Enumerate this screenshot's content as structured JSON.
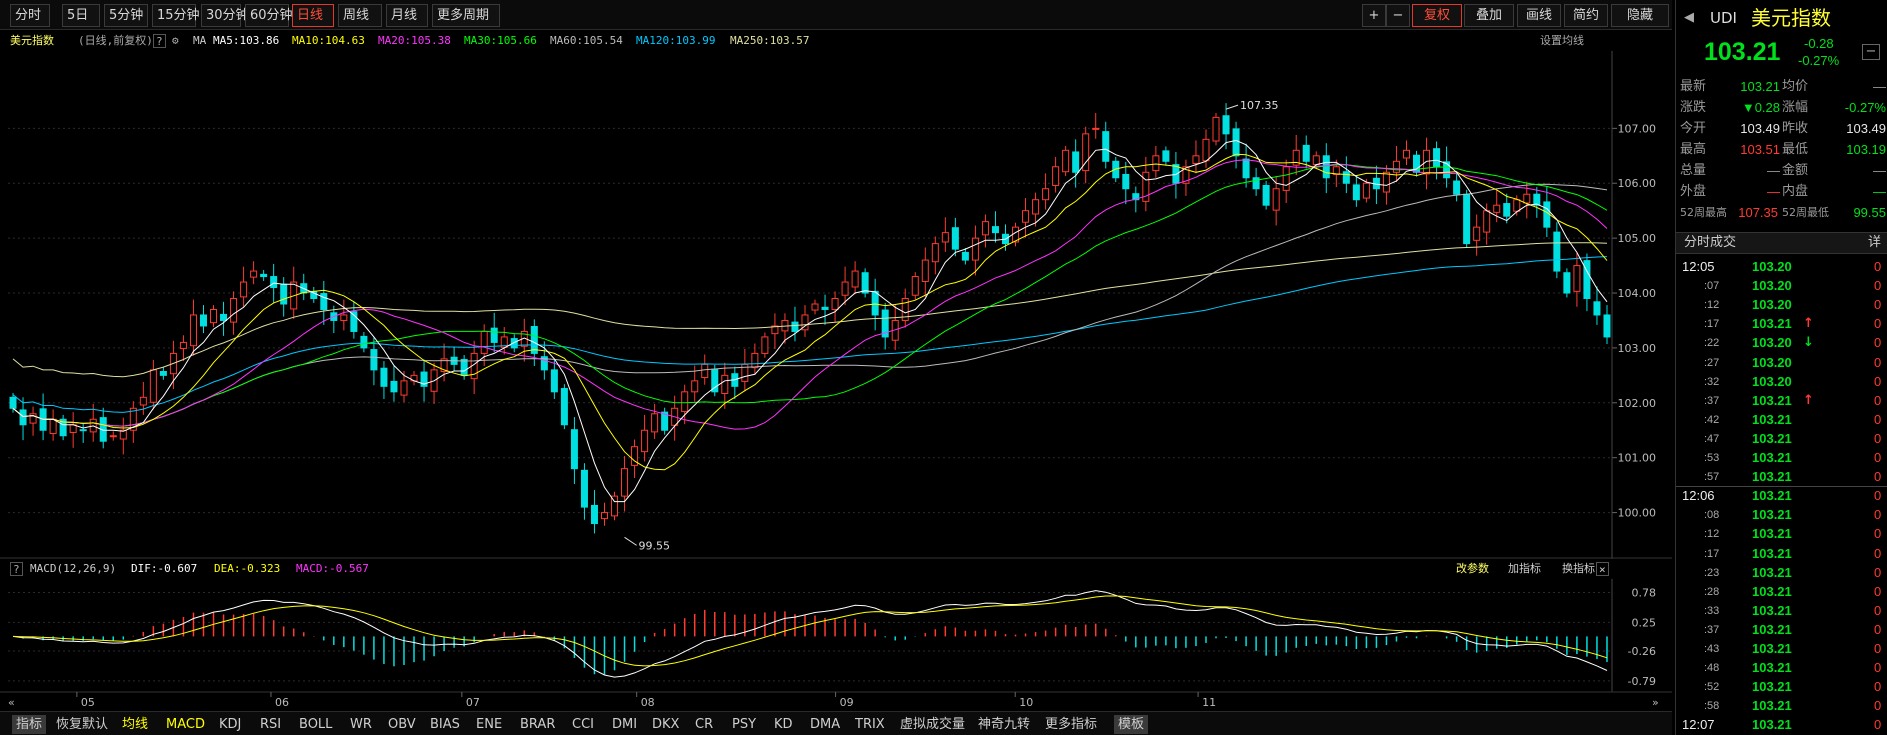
{
  "toolbar": {
    "periods": [
      "分时",
      "5日",
      "5分钟",
      "15分钟",
      "30分钟",
      "60分钟",
      "日线",
      "周线",
      "月线",
      "更多周期"
    ],
    "active": "日线",
    "plus": "+",
    "minus": "−",
    "adjust": "复权",
    "overlay": "叠加",
    "draw": "画线",
    "simple": "简约",
    "hide": "隐藏"
  },
  "legend": {
    "name": "美元指数",
    "mode": "(日线,前复权)",
    "q": "?",
    "ma_label": "MA",
    "ma5": "MA5:103.86",
    "ma10": "MA10:104.63",
    "ma20": "MA20:105.38",
    "ma30": "MA30:105.66",
    "ma60": "MA60:105.54",
    "ma120": "MA120:103.99",
    "ma250": "MA250:103.57",
    "settings": "设置均线"
  },
  "macd_legend": {
    "q": "?",
    "name": "MACD(12,26,9)",
    "dif": "DIF:-0.607",
    "dea": "DEA:-0.323",
    "macd": "MACD:-0.567",
    "edit": "改参数",
    "add": "加指标",
    "switch": "换指标",
    "close": "×"
  },
  "colors": {
    "up": "#ff3b30",
    "down": "#00e0e0",
    "ma5": "#ffffff",
    "ma10": "#ffff00",
    "ma20": "#ff33ff",
    "ma30": "#00ff00",
    "ma60": "#bbbbbb",
    "ma120": "#00c8ff",
    "ma250": "#e0e0a0"
  },
  "chart_data": [
    {
      "type": "candlestick",
      "title": "美元指数",
      "x_ticks": [
        "05",
        "06",
        "07",
        "08",
        "09",
        "10",
        "11"
      ],
      "y_ticks": [
        100.0,
        101.0,
        102.0,
        103.0,
        104.0,
        105.0,
        106.0,
        107.0
      ],
      "ylim": [
        99.3,
        108.3
      ],
      "annotations": [
        {
          "label": "107.35",
          "x": 121,
          "y": 107.35
        },
        {
          "label": "99.55",
          "x": 61,
          "y": 99.55
        }
      ],
      "close": [
        101.9,
        101.6,
        101.8,
        101.5,
        101.7,
        101.4,
        101.6,
        101.5,
        101.7,
        101.3,
        101.4,
        101.5,
        101.9,
        102.1,
        102.6,
        102.5,
        102.9,
        103.1,
        103.6,
        103.4,
        103.7,
        103.5,
        103.9,
        104.2,
        104.4,
        104.3,
        104.1,
        103.8,
        104.2,
        104.0,
        103.9,
        103.7,
        103.5,
        103.6,
        103.3,
        103.0,
        102.6,
        102.3,
        102.2,
        102.4,
        102.5,
        102.3,
        102.6,
        102.8,
        102.7,
        102.5,
        102.9,
        103.3,
        103.1,
        103.2,
        103.0,
        103.3,
        102.9,
        102.6,
        102.2,
        101.6,
        100.8,
        100.1,
        99.8,
        100.0,
        100.3,
        100.8,
        101.2,
        101.5,
        101.8,
        101.5,
        101.9,
        102.2,
        102.4,
        102.7,
        102.2,
        102.5,
        102.3,
        102.7,
        102.9,
        103.2,
        103.4,
        103.5,
        103.3,
        103.6,
        103.8,
        103.7,
        103.9,
        104.2,
        104.4,
        104.0,
        103.6,
        103.2,
        103.5,
        103.9,
        104.3,
        104.6,
        104.9,
        105.1,
        104.8,
        104.6,
        105.0,
        105.3,
        105.1,
        104.9,
        105.2,
        105.5,
        105.7,
        105.9,
        106.3,
        106.6,
        106.2,
        106.9,
        107.0,
        106.4,
        106.1,
        105.9,
        105.7,
        106.2,
        106.5,
        106.4,
        106.0,
        106.3,
        106.5,
        106.8,
        107.2,
        106.9,
        106.5,
        106.1,
        105.9,
        105.6,
        105.9,
        106.3,
        106.6,
        106.4,
        106.5,
        106.1,
        106.3,
        106.0,
        105.7,
        106.0,
        105.9,
        106.2,
        106.4,
        106.6,
        106.2,
        106.6,
        106.3,
        106.1,
        105.8,
        104.9,
        105.2,
        105.5,
        105.6,
        105.4,
        105.7,
        105.8,
        105.6,
        105.2,
        104.4,
        104.0,
        104.5,
        103.9,
        103.6,
        103.2
      ]
    },
    {
      "type": "bar",
      "title": "MACD(12,26,9)",
      "y_ticks": [
        0.78,
        0.25,
        -0.26,
        -0.79
      ],
      "ylim": [
        -0.9,
        0.95
      ]
    }
  ],
  "right_panel": {
    "code": "UDI",
    "name": "美元指数",
    "price": "103.21",
    "change": "-0.28",
    "pct": "-0.27%",
    "stats": [
      {
        "l1": "最新",
        "v1": "103.21",
        "c1": "green",
        "l2": "均价",
        "v2": "—",
        "c2": "gray"
      },
      {
        "l1": "涨跌",
        "v1": "▼0.28",
        "c1": "green",
        "l2": "涨幅",
        "v2": "-0.27%",
        "c2": "green"
      },
      {
        "l1": "今开",
        "v1": "103.49",
        "c1": "white",
        "l2": "昨收",
        "v2": "103.49",
        "c2": "white"
      },
      {
        "l1": "最高",
        "v1": "103.51",
        "c1": "red",
        "l2": "最低",
        "v2": "103.19",
        "c2": "green"
      },
      {
        "l1": "总量",
        "v1": "—",
        "c1": "gray",
        "l2": "金额",
        "v2": "—",
        "c2": "gray"
      },
      {
        "l1": "外盘",
        "v1": "—",
        "c1": "red",
        "l2": "内盘",
        "v2": "—",
        "c2": "green"
      },
      {
        "l1": "52周最高",
        "v1": "107.35",
        "c1": "red",
        "l2": "52周最低",
        "v2": "99.55",
        "c2": "green"
      }
    ],
    "ticks_title": "分时成交",
    "ticks_detail": "详",
    "ticks": [
      {
        "t": "12:05",
        "p": "103.20",
        "a": "",
        "v": "0"
      },
      {
        "t": ":07",
        "p": "103.20",
        "a": "",
        "v": "0"
      },
      {
        "t": ":12",
        "p": "103.20",
        "a": "",
        "v": "0"
      },
      {
        "t": ":17",
        "p": "103.21",
        "a": "up",
        "v": "0"
      },
      {
        "t": ":22",
        "p": "103.20",
        "a": "down",
        "v": "0"
      },
      {
        "t": ":27",
        "p": "103.20",
        "a": "",
        "v": "0"
      },
      {
        "t": ":32",
        "p": "103.20",
        "a": "",
        "v": "0"
      },
      {
        "t": ":37",
        "p": "103.21",
        "a": "up",
        "v": "0"
      },
      {
        "t": ":42",
        "p": "103.21",
        "a": "",
        "v": "0"
      },
      {
        "t": ":47",
        "p": "103.21",
        "a": "",
        "v": "0"
      },
      {
        "t": ":53",
        "p": "103.21",
        "a": "",
        "v": "0"
      },
      {
        "t": ":57",
        "p": "103.21",
        "a": "",
        "v": "0"
      },
      {
        "t": "12:06",
        "p": "103.21",
        "a": "",
        "v": "0"
      },
      {
        "t": ":08",
        "p": "103.21",
        "a": "",
        "v": "0"
      },
      {
        "t": ":12",
        "p": "103.21",
        "a": "",
        "v": "0"
      },
      {
        "t": ":17",
        "p": "103.21",
        "a": "",
        "v": "0"
      },
      {
        "t": ":23",
        "p": "103.21",
        "a": "",
        "v": "0"
      },
      {
        "t": ":28",
        "p": "103.21",
        "a": "",
        "v": "0"
      },
      {
        "t": ":33",
        "p": "103.21",
        "a": "",
        "v": "0"
      },
      {
        "t": ":37",
        "p": "103.21",
        "a": "",
        "v": "0"
      },
      {
        "t": ":43",
        "p": "103.21",
        "a": "",
        "v": "0"
      },
      {
        "t": ":48",
        "p": "103.21",
        "a": "",
        "v": "0"
      },
      {
        "t": ":52",
        "p": "103.21",
        "a": "",
        "v": "0"
      },
      {
        "t": ":58",
        "p": "103.21",
        "a": "",
        "v": "0"
      },
      {
        "t": "12:07",
        "p": "103.21",
        "a": "",
        "v": "0"
      }
    ]
  },
  "bottom": {
    "tabs": [
      "指标",
      "恢复默认",
      "均线",
      "MACD",
      "KDJ",
      "RSI",
      "BOLL",
      "WR",
      "OBV",
      "BIAS",
      "ENE",
      "BRAR",
      "CCI",
      "DMI",
      "DKX",
      "CR",
      "PSY",
      "KD",
      "DMA",
      "TRIX",
      "虚拟成交量",
      "神奇九转",
      "更多指标",
      "模板"
    ]
  }
}
